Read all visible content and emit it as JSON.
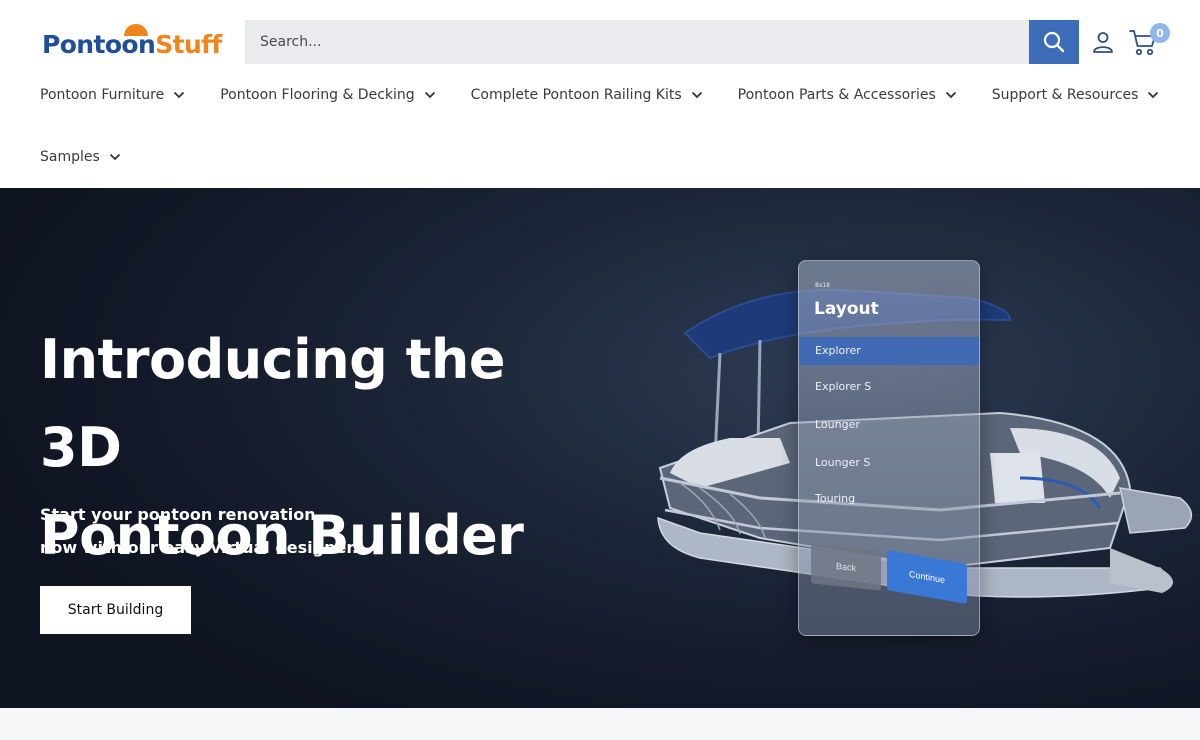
{
  "brand": {
    "name_part1": "Pontoon",
    "name_part2": "Stuff",
    "primary_color": "#1f4e9c",
    "accent_color": "#f0851c"
  },
  "search": {
    "placeholder": "Search...",
    "button_icon": "search-icon"
  },
  "header_icons": {
    "account": "user-icon",
    "cart": "cart-icon",
    "cart_count": "0"
  },
  "nav": {
    "items": [
      {
        "label": "Pontoon Furniture"
      },
      {
        "label": "Pontoon Flooring & Decking"
      },
      {
        "label": "Complete Pontoon Railing Kits"
      },
      {
        "label": "Pontoon Parts & Accessories"
      },
      {
        "label": "Support & Resources"
      },
      {
        "label": "Samples"
      }
    ]
  },
  "hero": {
    "title_line1": "Introducing the 3D",
    "title_line2": "Pontoon Builder",
    "subtitle_line1": "Start your pontoon renovation",
    "subtitle_line2": "now with our easy virtual designer.",
    "cta_label": "Start Building",
    "panel": {
      "code": "8x18",
      "title": "Layout",
      "options": [
        "Explorer",
        "Explorer S",
        "Lounger",
        "Lounger S",
        "Touring"
      ],
      "selected_option": "Explorer",
      "back_label": "Back",
      "continue_label": "Continue"
    }
  }
}
